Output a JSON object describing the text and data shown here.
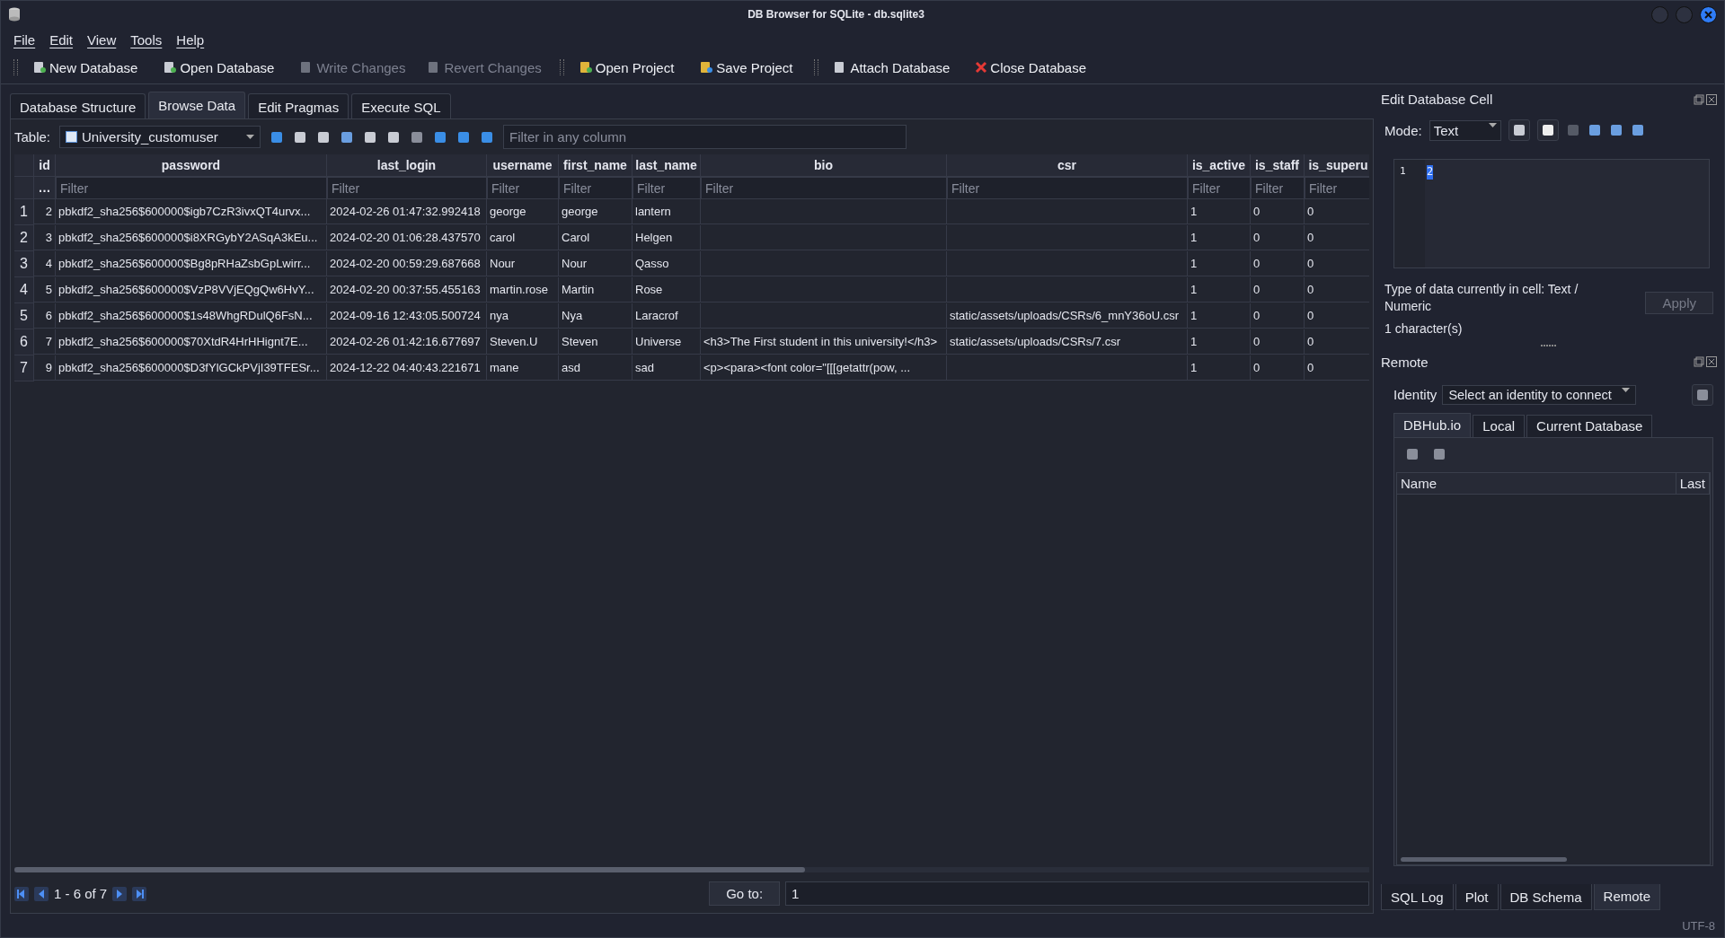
{
  "window": {
    "title": "DB Browser for SQLite - db.sqlite3"
  },
  "menu": [
    "File",
    "Edit",
    "View",
    "Tools",
    "Help"
  ],
  "toolbar": [
    {
      "label": "New Database",
      "disabled": false,
      "kind": "new"
    },
    {
      "label": "Open Database",
      "disabled": false,
      "kind": "open"
    },
    {
      "label": "Write Changes",
      "disabled": true,
      "kind": "write"
    },
    {
      "label": "Revert Changes",
      "disabled": true,
      "kind": "revert"
    },
    {
      "label": "Open Project",
      "disabled": false,
      "kind": "project-open"
    },
    {
      "label": "Save Project",
      "disabled": false,
      "kind": "project-save"
    },
    {
      "label": "Attach Database",
      "disabled": false,
      "kind": "attach"
    },
    {
      "label": "Close Database",
      "disabled": false,
      "kind": "close"
    }
  ],
  "tabs": [
    {
      "label": "Database Structure",
      "selected": false
    },
    {
      "label": "Browse Data",
      "selected": true
    },
    {
      "label": "Edit Pragmas",
      "selected": false
    },
    {
      "label": "Execute SQL",
      "selected": false
    }
  ],
  "table_bar": {
    "label": "Table:",
    "table": "University_customuser",
    "filter_placeholder": "Filter in any column"
  },
  "grid": {
    "columns": [
      "id",
      "password",
      "last_login",
      "username",
      "first_name",
      "last_name",
      "bio",
      "csr",
      "is_active",
      "is_staff",
      "is_superu"
    ],
    "id_filter": "…",
    "filter_placeholders": [
      "Filter",
      "Filter",
      "Filter",
      "Filter",
      "Filter",
      "Filter",
      "Filter",
      "Filter",
      "Filter",
      "Filter"
    ],
    "rows": [
      {
        "number": "1",
        "cells": [
          "2",
          "pbkdf2_sha256$600000$igb7CzR3ivxQT4urvx...",
          "2024-02-26 01:47:32.992418",
          "george",
          "george",
          "lantern",
          null,
          null,
          "1",
          "0",
          "0"
        ]
      },
      {
        "number": "2",
        "cells": [
          "3",
          "pbkdf2_sha256$600000$i8XRGybY2ASqA3kEu...",
          "2024-02-20 01:06:28.437570",
          "carol",
          "Carol",
          "Helgen",
          null,
          null,
          "1",
          "0",
          "0"
        ]
      },
      {
        "number": "3",
        "cells": [
          "4",
          "pbkdf2_sha256$600000$Bg8pRHaZsbGpLwirr...",
          "2024-02-20 00:59:29.687668",
          "Nour",
          "Nour",
          "Qasso",
          null,
          null,
          "1",
          "0",
          "0"
        ]
      },
      {
        "number": "4",
        "cells": [
          "5",
          "pbkdf2_sha256$600000$VzP8VVjEQgQw6HvY...",
          "2024-02-20 00:37:55.455163",
          "martin.rose",
          "Martin",
          "Rose",
          null,
          null,
          "1",
          "0",
          "0"
        ]
      },
      {
        "number": "5",
        "cells": [
          "6",
          "pbkdf2_sha256$600000$1s48WhgRDulQ6FsN...",
          "2024-09-16 12:43:05.500724",
          "nya",
          "Nya",
          "Laracrof",
          null,
          "static/assets/uploads/CSRs/6_mnY36oU.csr",
          "1",
          "0",
          "0"
        ]
      },
      {
        "number": "6",
        "cells": [
          "7",
          "pbkdf2_sha256$600000$70XtdR4HrHHignt7E...",
          "2024-02-26 01:42:16.677697",
          "Steven.U",
          "Steven",
          "Universe",
          "<h3>The First student in this university!</h3>",
          "static/assets/uploads/CSRs/7.csr",
          "1",
          "0",
          "0"
        ]
      },
      {
        "number": "7",
        "cells": [
          "9",
          "pbkdf2_sha256$600000$D3fYlGCkPVjI39TFESr...",
          "2024-12-22 04:40:43.221671",
          "mane",
          "asd",
          "sad",
          "<p><para><font color=\"[[[getattr(pow, ...",
          null,
          "1",
          "0",
          "0"
        ]
      }
    ]
  },
  "pager": {
    "range": "1 - 6 of 7",
    "goto_label": "Go to:",
    "goto_value": "1"
  },
  "edit_cell": {
    "title": "Edit Database Cell",
    "mode_label": "Mode:",
    "mode": "Text",
    "line_number": "1",
    "content": "2",
    "type_info": "Type of data currently in cell: Text / Numeric",
    "char_count": "1 character(s)",
    "apply": {
      "label": "Apply",
      "disabled": true
    }
  },
  "remote": {
    "title": "Remote",
    "identity_label": "Identity",
    "identity": "Select an identity to connect",
    "tabs": [
      {
        "label": "DBHub.io",
        "selected": true
      },
      {
        "label": "Local",
        "selected": false
      },
      {
        "label": "Current Database",
        "selected": false
      }
    ],
    "columns": [
      "Name",
      "Last"
    ]
  },
  "bottom_tabs": [
    {
      "label": "SQL Log",
      "selected": false
    },
    {
      "label": "Plot",
      "selected": false
    },
    {
      "label": "DB Schema",
      "selected": false
    },
    {
      "label": "Remote",
      "selected": true
    }
  ],
  "status": "UTF-8"
}
